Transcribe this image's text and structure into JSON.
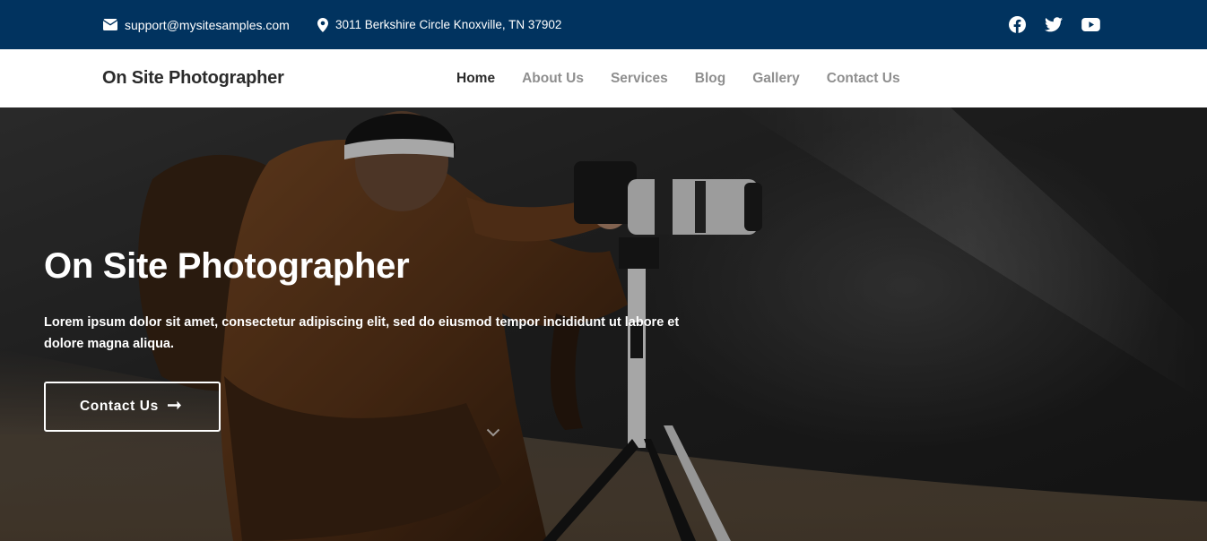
{
  "topbar": {
    "email": "support@mysitesamples.com",
    "address": "3011 Berkshire Circle Knoxville, TN 37902",
    "socials": [
      {
        "icon": "facebook-icon"
      },
      {
        "icon": "twitter-icon"
      },
      {
        "icon": "youtube-icon"
      }
    ],
    "background_color": "#01335f"
  },
  "navbar": {
    "brand": "On Site Photographer",
    "items": [
      {
        "label": "Home",
        "active": true
      },
      {
        "label": "About Us",
        "active": false
      },
      {
        "label": "Services",
        "active": false
      },
      {
        "label": "Blog",
        "active": false
      },
      {
        "label": "Gallery",
        "active": false
      },
      {
        "label": "Contact Us",
        "active": false
      }
    ],
    "active_color": "#2b2b2b",
    "inactive_color": "#8f8f8f"
  },
  "hero": {
    "title": "On Site Photographer",
    "text": "Lorem ipsum dolor sit amet, consectetur adipiscing elit, sed do eiusmod tempor incididunt ut labore et dolore magna aliqua.",
    "button_label": "Contact Us",
    "button_icon": "arrow-right-icon",
    "scroll_icon": "chevron-down-icon"
  }
}
